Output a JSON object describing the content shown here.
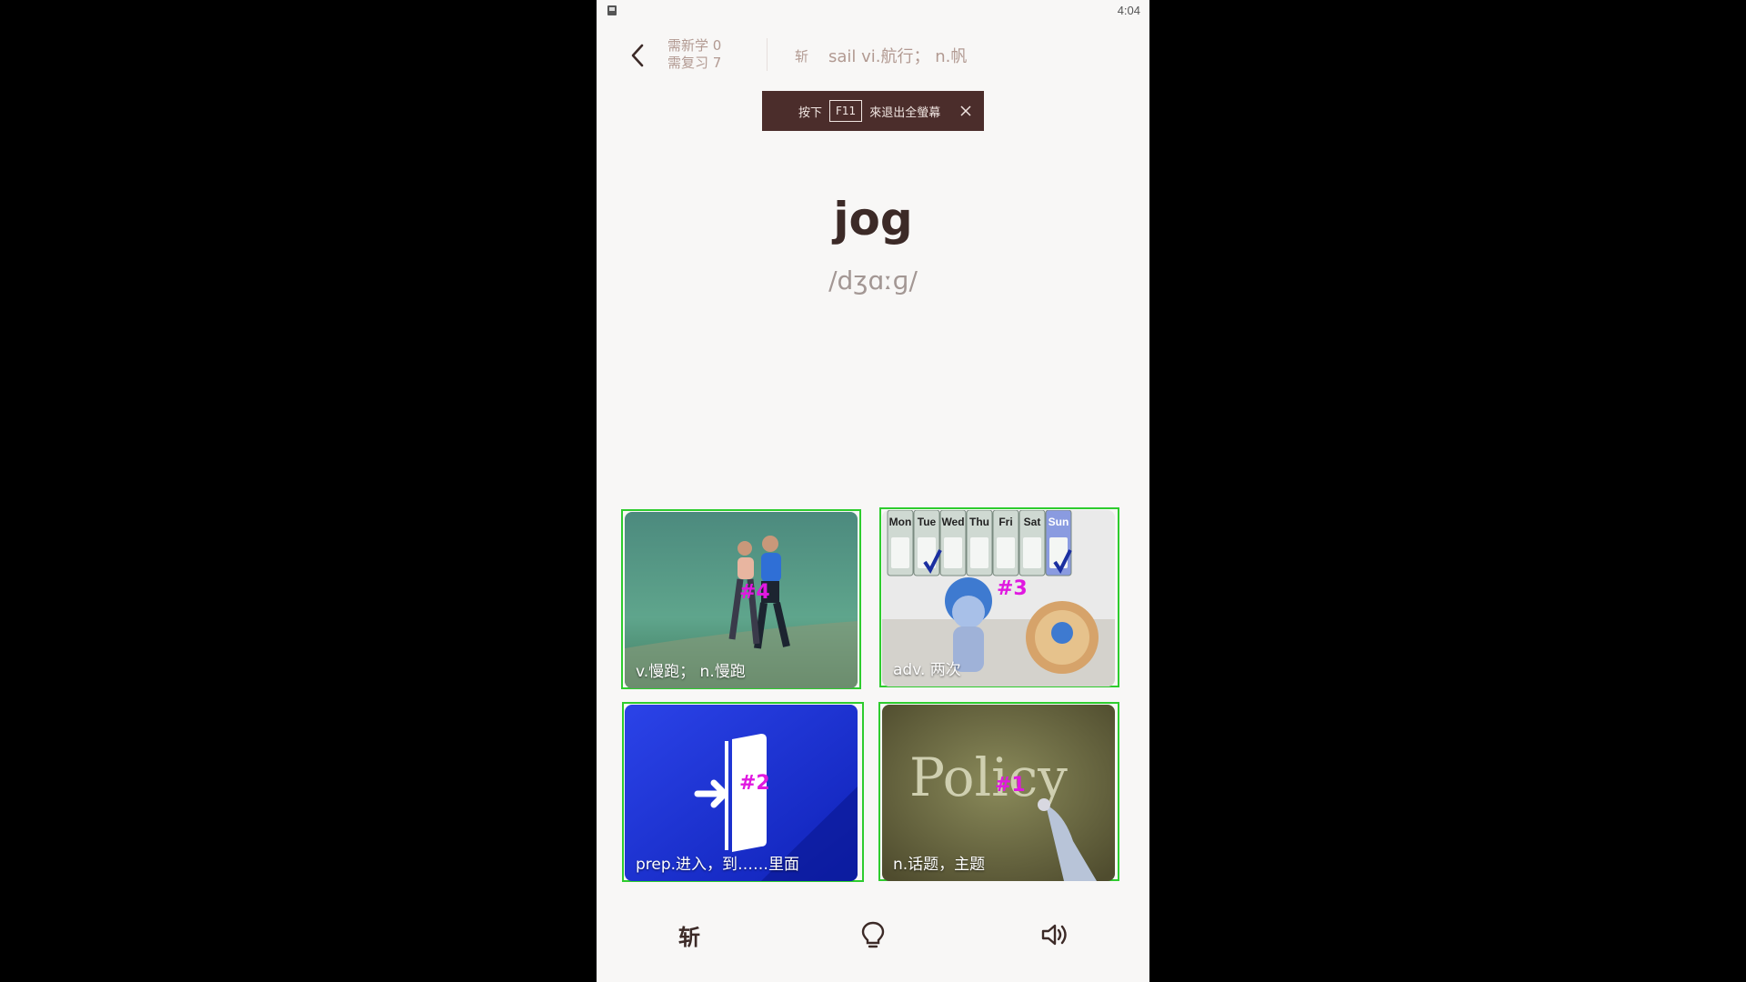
{
  "status_bar": {
    "time": "4:04"
  },
  "header": {
    "new_learn": "需新学 0",
    "review": "需复习 7",
    "prev_word_icon_label": "斩",
    "prev_word_definition": "sail vi.航行； n.帆"
  },
  "toast": {
    "prefix": "按下",
    "key": "F11",
    "suffix": "來退出全螢幕"
  },
  "word": {
    "text": "jog",
    "phonetic": "/dʒɑːɡ/"
  },
  "options": [
    {
      "label": "v.慢跑； n.慢跑",
      "marker": "#4",
      "image": "joggers-photo"
    },
    {
      "label": "adv. 两次",
      "marker": "#3",
      "image": "weekly-calendar-cartoon",
      "calendar_days": [
        "Mon",
        "Tue",
        "Wed",
        "Thu",
        "Fri",
        "Sat",
        "Sun"
      ]
    },
    {
      "label": "prep.进入，到……里面",
      "marker": "#2",
      "image": "enter-door-icon"
    },
    {
      "label": "n.话题，主题",
      "marker": "#1",
      "image": "policy-chalkboard",
      "board_text": "Policy"
    }
  ],
  "bottom_bar": {
    "zhan_label": "斩",
    "hint_icon": "lightbulb-icon",
    "audio_icon": "speaker-icon"
  },
  "colors": {
    "background": "#f8f7f6",
    "text_dark": "#3c2a27",
    "text_muted": "#b29a92",
    "toast_bg": "#4b2d2b",
    "outline": "#2ecc2e",
    "marker": "#e018e0"
  }
}
